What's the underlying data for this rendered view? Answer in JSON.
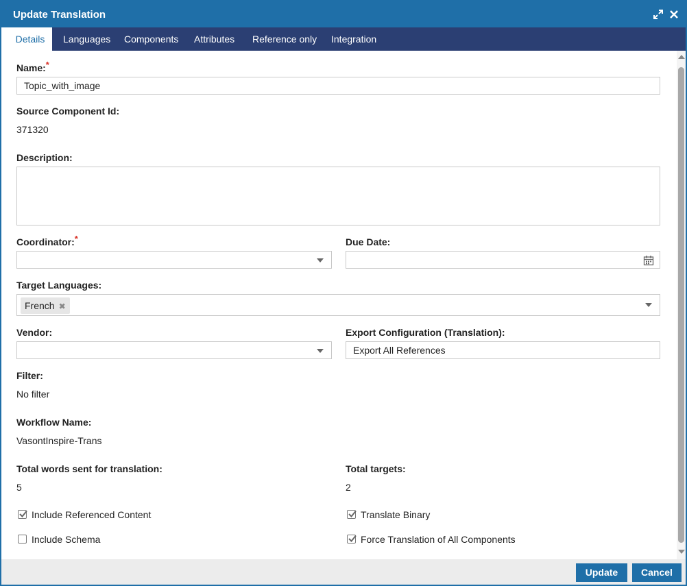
{
  "dialog": {
    "title": "Update Translation"
  },
  "tabs": [
    {
      "label": "Details"
    },
    {
      "label": "Languages"
    },
    {
      "label": "Components"
    },
    {
      "label": "Attributes"
    },
    {
      "label": "Reference only"
    },
    {
      "label": "Integration"
    }
  ],
  "form": {
    "name_label": "Name:",
    "name_value": "Topic_with_image",
    "source_id_label": "Source Component Id:",
    "source_id_value": "371320",
    "description_label": "Description:",
    "description_value": "",
    "coordinator_label": "Coordinator:",
    "coordinator_value": "",
    "due_date_label": "Due Date:",
    "due_date_value": "",
    "target_languages_label": "Target Languages:",
    "target_languages": [
      "French"
    ],
    "vendor_label": "Vendor:",
    "vendor_value": "",
    "export_config_label": "Export Configuration (Translation):",
    "export_config_value": "Export All References",
    "filter_label": "Filter:",
    "filter_value": "No filter",
    "workflow_label": "Workflow Name:",
    "workflow_value": "VasontInspire-Trans",
    "total_words_label": "Total words sent for translation:",
    "total_words_value": "5",
    "total_targets_label": "Total targets:",
    "total_targets_value": "2",
    "required_mark": "*"
  },
  "checkboxes": {
    "include_referenced": {
      "label": "Include Referenced Content",
      "checked": true
    },
    "include_schema": {
      "label": "Include Schema",
      "checked": false
    },
    "translate_binary": {
      "label": "Translate Binary",
      "checked": true
    },
    "force_translation": {
      "label": "Force Translation of All Components",
      "checked": true
    }
  },
  "footer": {
    "update_label": "Update",
    "cancel_label": "Cancel"
  },
  "colors": {
    "titlebar": "#1f6fa8",
    "tabbar": "#2b3f73",
    "button": "#1f6fa8",
    "required": "#d9362b"
  },
  "icons": {
    "expand": "expand-icon",
    "close": "close-icon",
    "calendar": "calendar-icon",
    "dropdown": "chevron-down-icon"
  }
}
